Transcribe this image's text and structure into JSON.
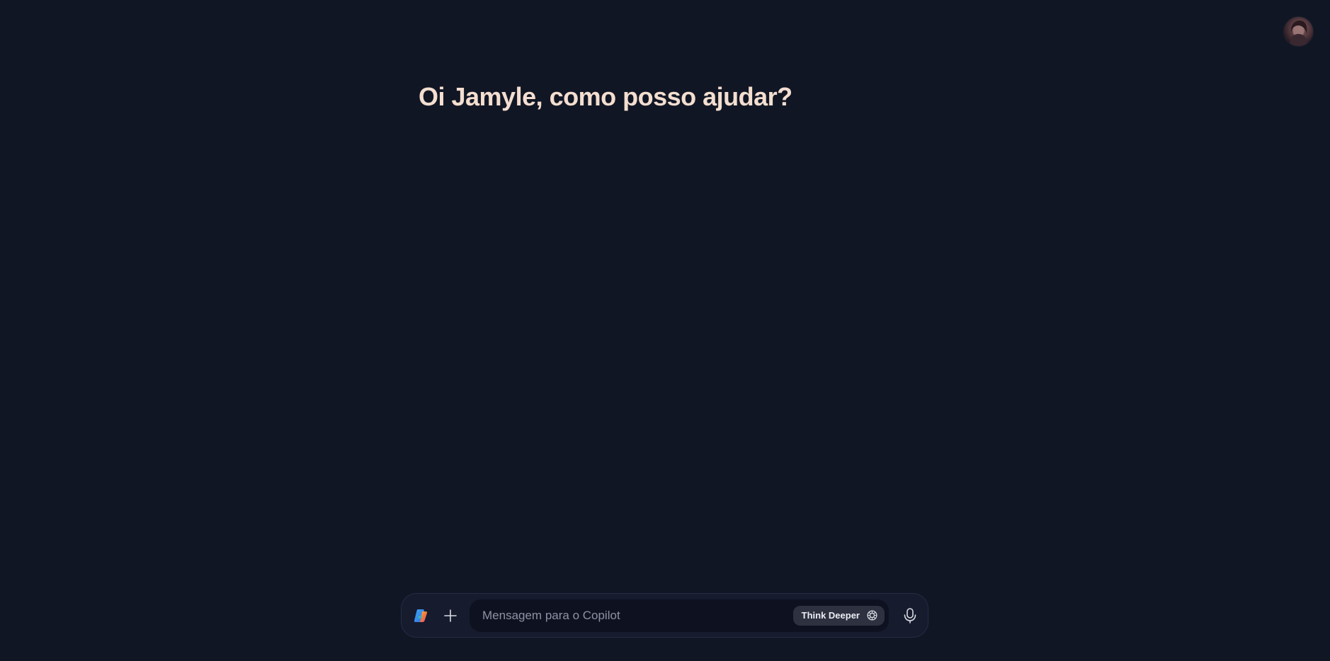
{
  "header": {
    "avatar_icon": "user-avatar-photo"
  },
  "main": {
    "greeting": "Oi Jamyle, como posso ajudar?"
  },
  "composer": {
    "logo_icon": "copilot-logo-icon",
    "plus_icon": "plus-icon",
    "input_value": "",
    "input_placeholder": "Mensagem para o Copilot",
    "think_deeper_label": "Think Deeper",
    "think_deeper_icon": "think-deeper-icon",
    "mic_icon": "microphone-icon"
  },
  "colors": {
    "background": "#111624",
    "greeting_text": "#f3ded0",
    "composer_bg": "#161b2e",
    "input_bg": "#0e1220",
    "pill_bg": "#2e3140"
  }
}
